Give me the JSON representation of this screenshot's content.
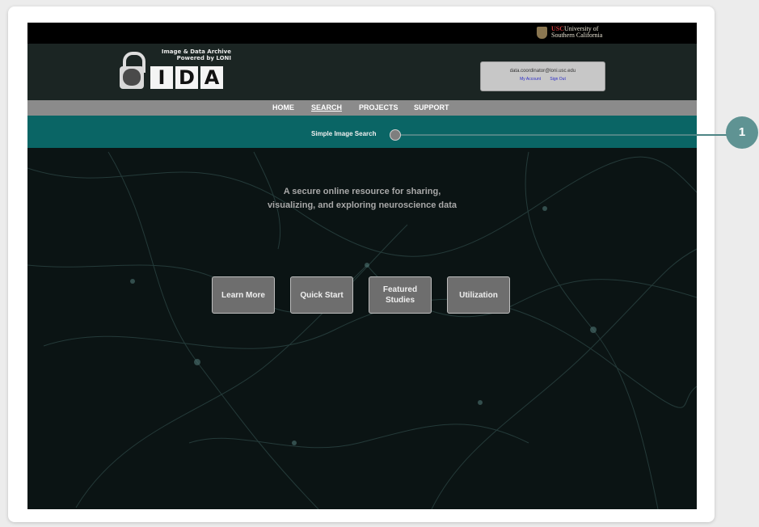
{
  "header": {
    "university": {
      "prefix": "USC",
      "line1": "University of",
      "line2": "Southern California"
    },
    "logo": {
      "tagline_line1": "Image & Data Archive",
      "tagline_line2": "Powered by LONI",
      "letters": [
        "I",
        "D",
        "A"
      ]
    },
    "account": {
      "email": "data.coordinator@loni.usc.edu",
      "my_account": "My Account",
      "sign_out": "Sign Out"
    }
  },
  "nav": {
    "items": [
      "HOME",
      "SEARCH",
      "PROJECTS",
      "SUPPORT"
    ],
    "active": "SEARCH"
  },
  "subnav": {
    "item": "Simple Image Search"
  },
  "main": {
    "tagline_line1": "A secure online resource for sharing,",
    "tagline_line2": "visualizing, and exploring neuroscience data",
    "buttons": [
      "Learn More",
      "Quick Start",
      "Featured Studies",
      "Utilization"
    ]
  },
  "callout": {
    "number": "1"
  },
  "colors": {
    "nav_bar": "#8b8b8b",
    "subnav_bar": "#0a6565",
    "callout": "#5f9393",
    "background": "#0b1414"
  }
}
